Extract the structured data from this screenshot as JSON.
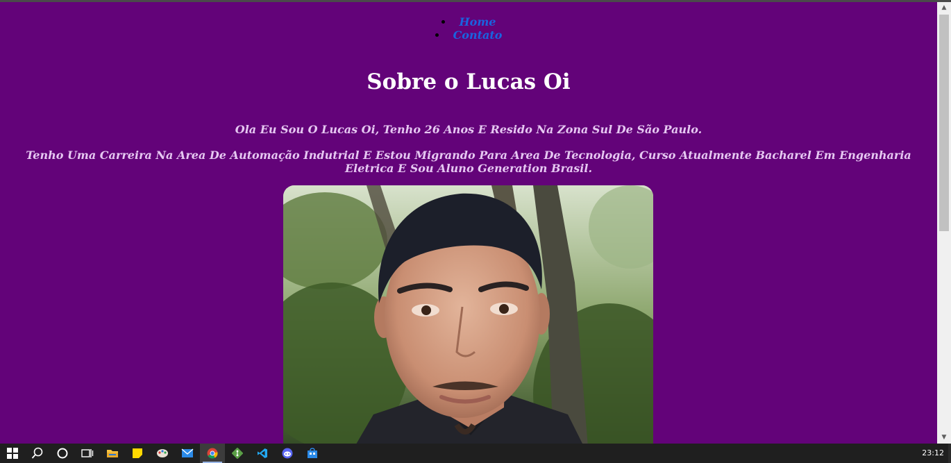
{
  "nav": {
    "items": [
      {
        "label": "Home"
      },
      {
        "label": "Contato"
      }
    ]
  },
  "page": {
    "title": "Sobre o Lucas Oi",
    "intro": "Ola Eu Sou O Lucas Oi, Tenho 26 Anos E Resido Na Zona Sul De São Paulo.",
    "career": "Tenho Uma Carreira Na Area De Automação Indutrial E Estou Migrando Para Area De Tecnologia, Curso Atualmente Bacharel Em Engenharia Eletrica E Sou Aluno Generation Brasil."
  },
  "colors": {
    "background": "#630379",
    "link": "#1a63e0",
    "text": "#e6c8f2",
    "heading": "#ffffff"
  },
  "taskbar": {
    "icons": [
      "windows-start-icon",
      "search-icon",
      "cortana-icon",
      "task-view-icon",
      "file-explorer-icon",
      "sticky-notes-icon",
      "paint-icon",
      "mail-icon",
      "chrome-icon",
      "git-icon",
      "vscode-icon",
      "discord-icon",
      "store-icon"
    ],
    "time": "23:12"
  }
}
